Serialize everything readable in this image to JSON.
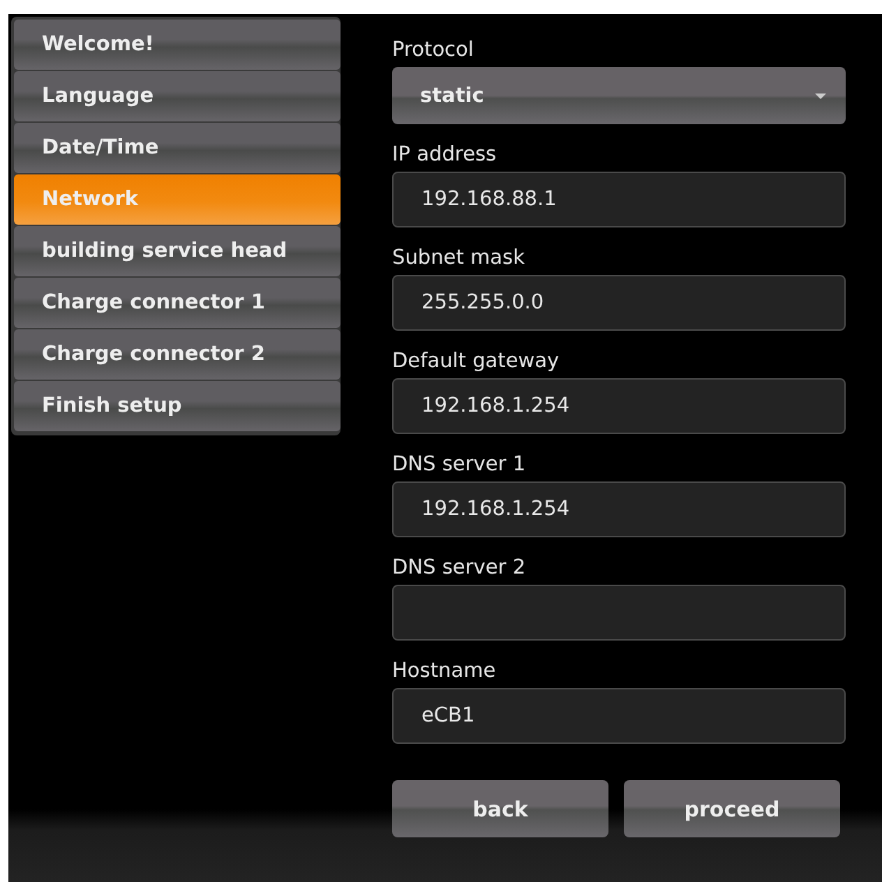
{
  "sidebar": {
    "items": [
      {
        "label": "Welcome!",
        "selected": false
      },
      {
        "label": "Language",
        "selected": false
      },
      {
        "label": "Date/Time",
        "selected": false
      },
      {
        "label": "Network",
        "selected": true
      },
      {
        "label": "building service head",
        "selected": false
      },
      {
        "label": "Charge connector 1",
        "selected": false
      },
      {
        "label": "Charge connector 2",
        "selected": false
      },
      {
        "label": "Finish setup",
        "selected": false
      }
    ]
  },
  "form": {
    "fields": [
      {
        "kind": "dropdown",
        "label": "Protocol",
        "value": "static"
      },
      {
        "kind": "text",
        "label": "IP address",
        "value": "192.168.88.1"
      },
      {
        "kind": "text",
        "label": "Subnet mask",
        "value": "255.255.0.0"
      },
      {
        "kind": "text",
        "label": "Default gateway",
        "value": "192.168.1.254"
      },
      {
        "kind": "text",
        "label": "DNS server 1",
        "value": "192.168.1.254"
      },
      {
        "kind": "text",
        "label": "DNS server 2"
      },
      {
        "kind": "text",
        "label": "Hostname",
        "value": "eCB1"
      }
    ]
  },
  "buttons": [
    "back",
    "proceed"
  ]
}
